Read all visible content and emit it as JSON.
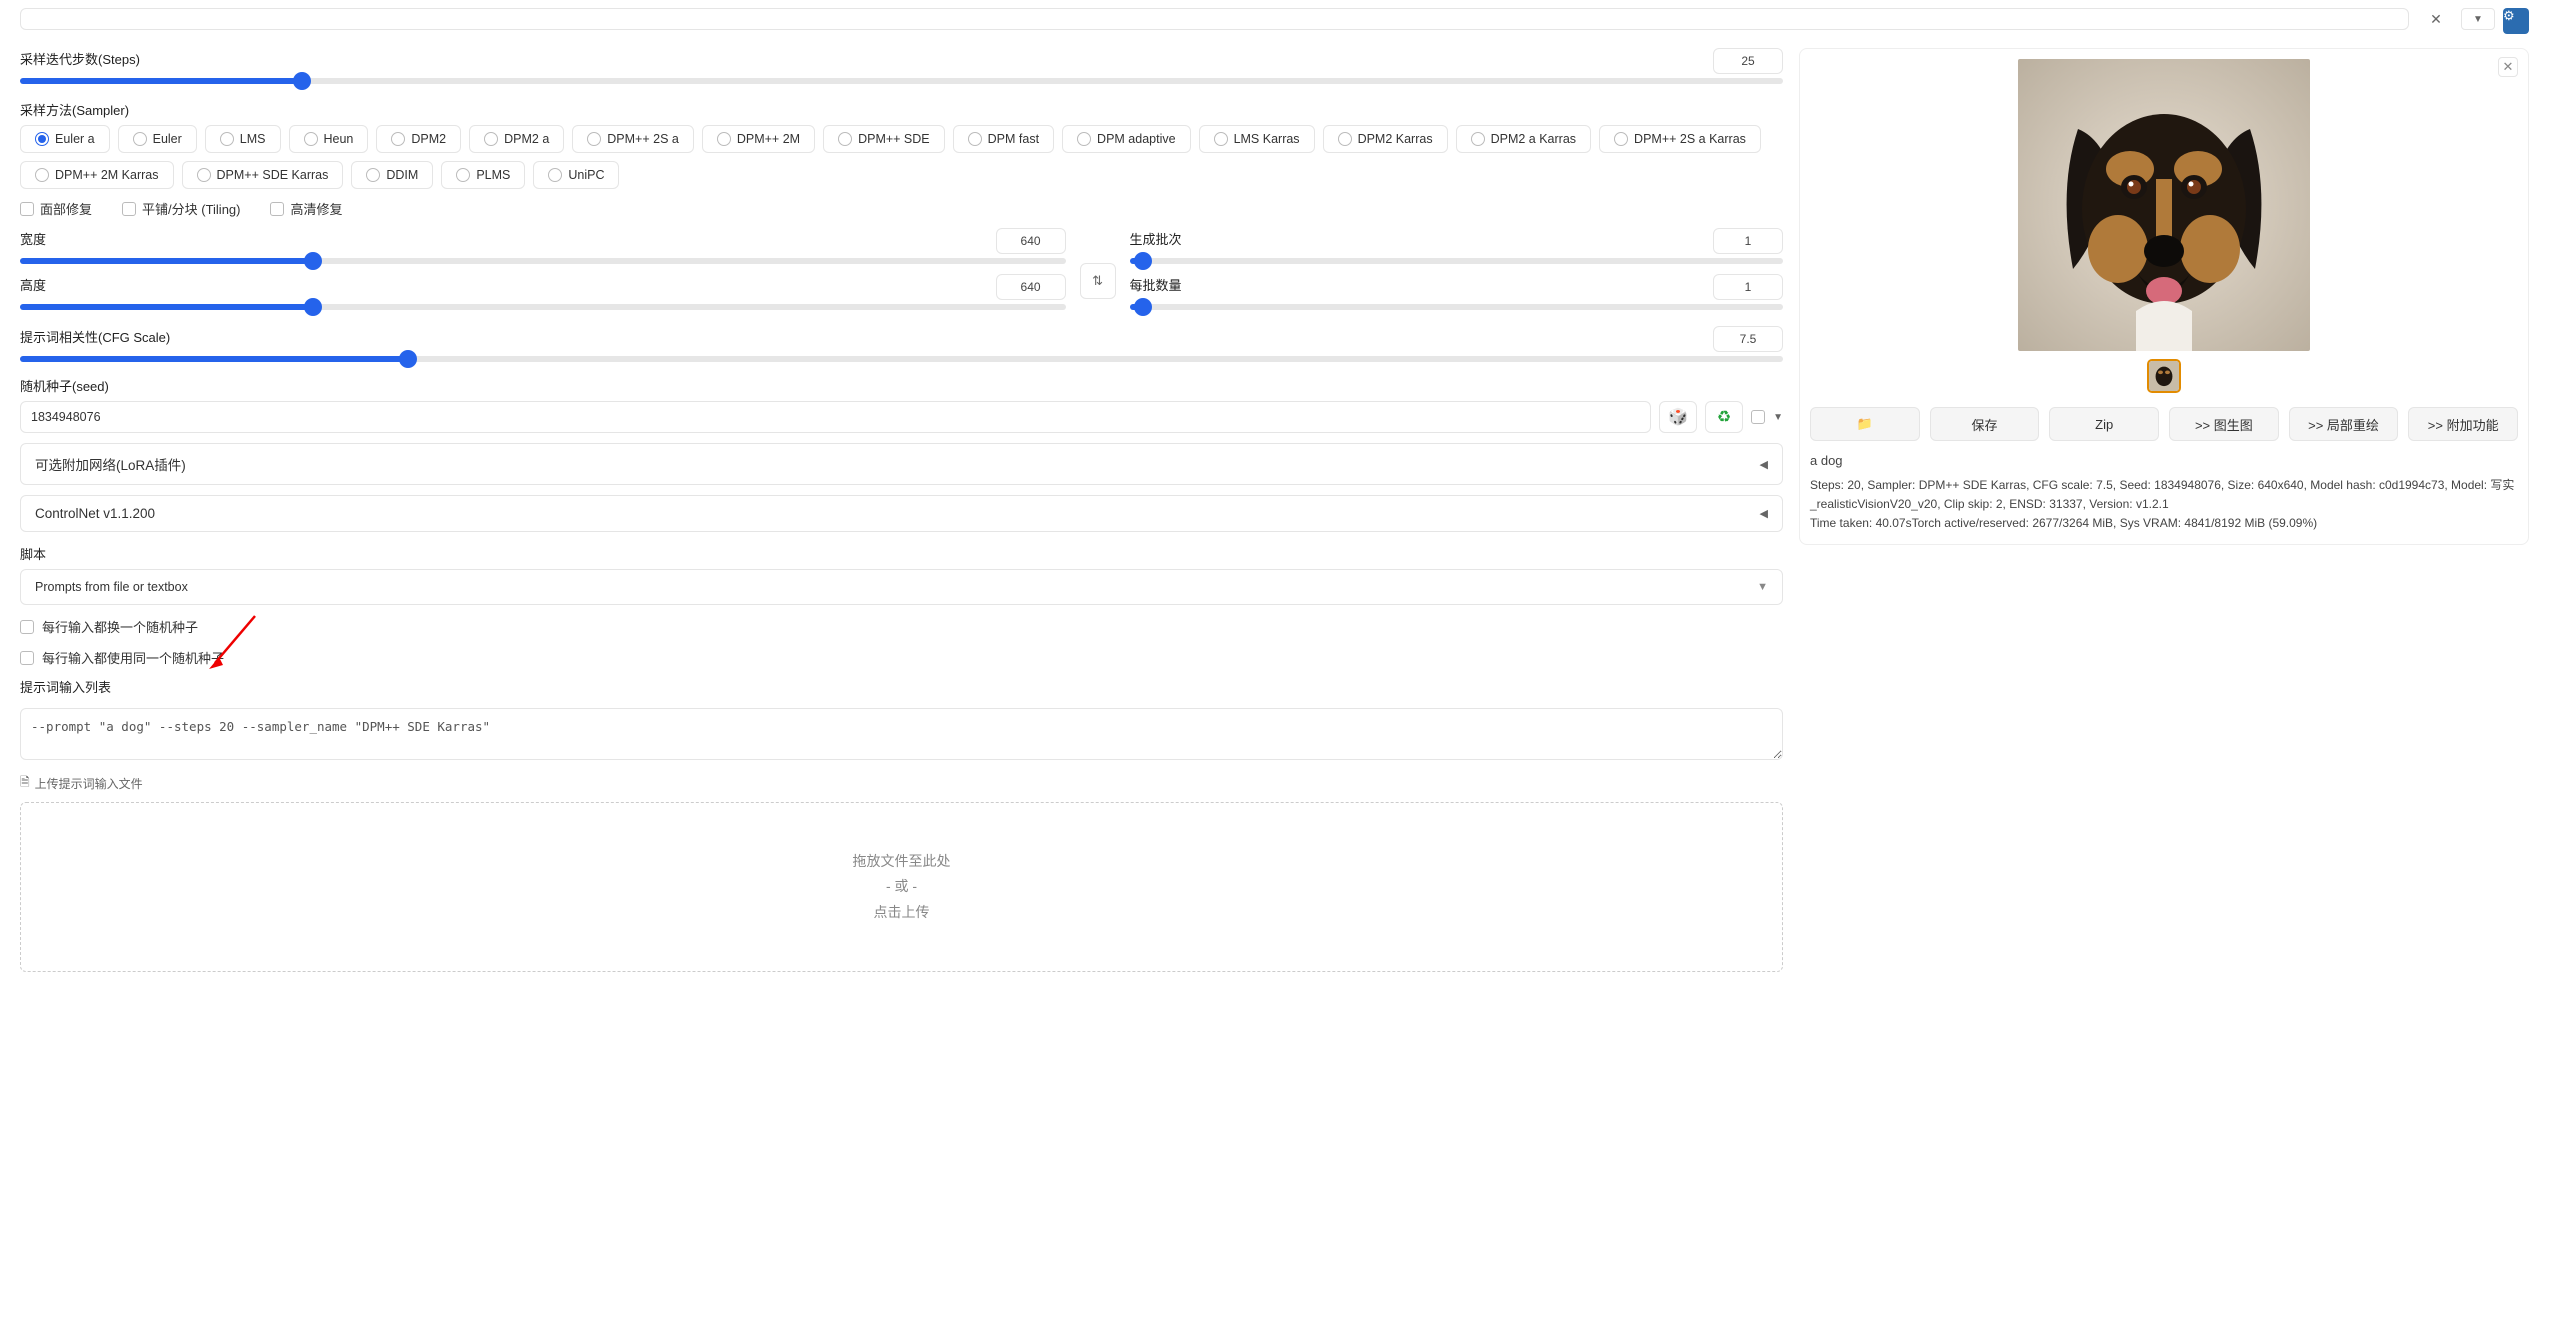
{
  "steps": {
    "label": "采样迭代步数(Steps)",
    "value": "25",
    "percent": 16
  },
  "sampler": {
    "label": "采样方法(Sampler)",
    "selected": "Euler a",
    "options": [
      "Euler a",
      "Euler",
      "LMS",
      "Heun",
      "DPM2",
      "DPM2 a",
      "DPM++ 2S a",
      "DPM++ 2M",
      "DPM++ SDE",
      "DPM fast",
      "DPM adaptive",
      "LMS Karras",
      "DPM2 Karras",
      "DPM2 a Karras",
      "DPM++ 2S a Karras",
      "DPM++ 2M Karras",
      "DPM++ SDE Karras",
      "DDIM",
      "PLMS",
      "UniPC"
    ]
  },
  "checks": {
    "face": "面部修复",
    "tiling": "平铺/分块 (Tiling)",
    "hires": "高清修复"
  },
  "width": {
    "label": "宽度",
    "value": "640",
    "percent": 28
  },
  "height": {
    "label": "高度",
    "value": "640",
    "percent": 28
  },
  "batch_count": {
    "label": "生成批次",
    "value": "1",
    "percent": 2
  },
  "batch_size": {
    "label": "每批数量",
    "value": "1",
    "percent": 2
  },
  "cfg": {
    "label": "提示词相关性(CFG Scale)",
    "value": "7.5",
    "percent": 22
  },
  "seed": {
    "label": "随机种子(seed)",
    "value": "1834948076"
  },
  "accordion1": "可选附加网络(LoRA插件)",
  "accordion2": "ControlNet v1.1.200",
  "script": {
    "label": "脚本",
    "selected": "Prompts from file or textbox"
  },
  "script_checks": {
    "iterate": "每行输入都换一个随机种子",
    "same": "每行输入都使用同一个随机种子"
  },
  "prompt_list": {
    "label": "提示词输入列表",
    "value": "--prompt \"a dog\" --steps 20 --sampler_name \"DPM++ SDE Karras\""
  },
  "upload_link": "上传提示词输入文件",
  "dropzone": {
    "line1": "拖放文件至此处",
    "line2": "- 或 -",
    "line3": "点击上传"
  },
  "output": {
    "prompt": "a dog",
    "buttons": {
      "folder": "📁",
      "save": "保存",
      "zip": "Zip",
      "img2img": ">> 图生图",
      "inpaint": ">> 局部重绘",
      "extras": ">> 附加功能"
    },
    "meta": "Steps: 20, Sampler: DPM++ SDE Karras, CFG scale: 7.5, Seed: 1834948076, Size: 640x640, Model hash: c0d1994c73, Model: 写实_realisticVisionV20_v20, Clip skip: 2, ENSD: 31337, Version: v1.2.1",
    "timing": "Time taken: 40.07sTorch active/reserved: 2677/3264 MiB, Sys VRAM: 4841/8192 MiB (59.09%)"
  }
}
